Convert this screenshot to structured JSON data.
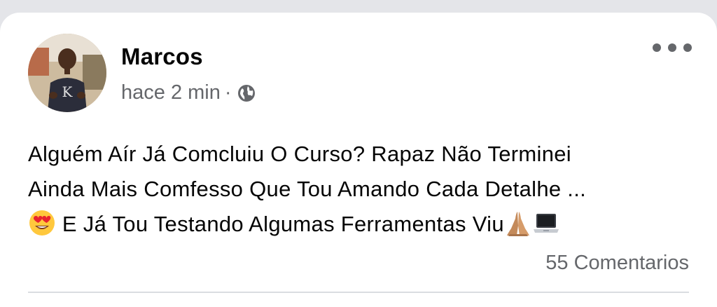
{
  "post": {
    "author": "Marcos",
    "timestamp": "hace 2 min",
    "separator": "·",
    "privacy_icon": "globe-icon",
    "text_lines": [
      "Alguém Aír Já Comcluiu O Curso? Rapaz Não Terminei",
      "Ainda Mais Comfesso Que Tou Amando Cada Detalhe ...",
      "E Já Tou Testando Algumas Ferramentas Viu"
    ],
    "emojis": [
      "heart-eyes-emoji",
      "praying-hands-emoji",
      "laptop-emoji"
    ],
    "comments_label": "55 Comentarios"
  },
  "colors": {
    "background": "#e4e5e9",
    "card": "#ffffff",
    "primary_text": "#050505",
    "secondary_text": "#65676b"
  }
}
